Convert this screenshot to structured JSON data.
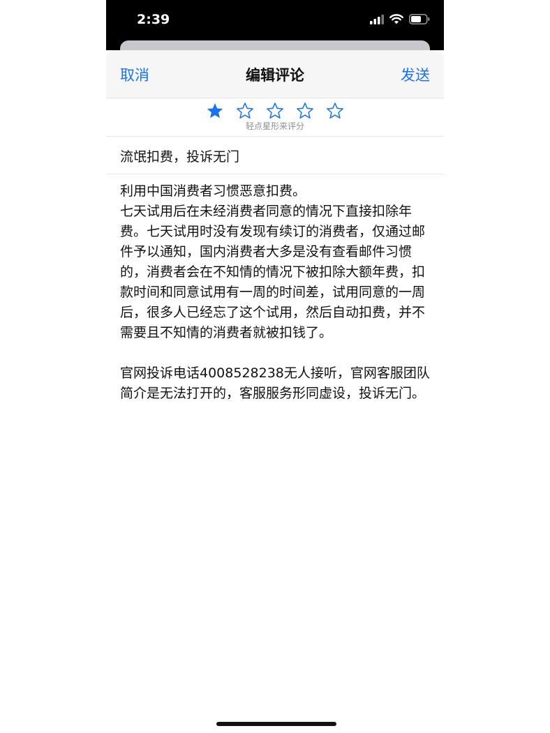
{
  "status_bar": {
    "time": "2:39"
  },
  "nav": {
    "cancel_label": "取消",
    "title": "编辑评论",
    "send_label": "发送"
  },
  "rating": {
    "value": 1,
    "max": 5,
    "hint": "轻点星形来评分"
  },
  "review": {
    "title": "流氓扣费，投诉无门",
    "body": "利用中国消费者习惯恶意扣费。\n七天试用后在未经消费者同意的情况下直接扣除年费。七天试用时没有发现有续订的消费者，仅通过邮件予以通知，国内消费者大多是没有查看邮件习惯的，消费者会在不知情的情况下被扣除大额年费，扣款时间和同意试用有一周的时间差，试用同意的一周后，很多人已经忘了这个试用，然后自动扣费，并不需要且不知情的消费者就被扣钱了。\n\n官网投诉电话4008528238无人接听，官网客服团队简介是无法打开的，客服服务形同虚设，投诉无门。"
  },
  "colors": {
    "accent": "#1a73e8",
    "status_bar_bg": "#000000",
    "nav_bg": "#f6f6f7"
  },
  "icons": {
    "signal": "cellular-signal-icon",
    "wifi": "wifi-icon",
    "battery": "battery-icon",
    "star_filled": "star-filled-icon",
    "star_empty": "star-outline-icon"
  }
}
